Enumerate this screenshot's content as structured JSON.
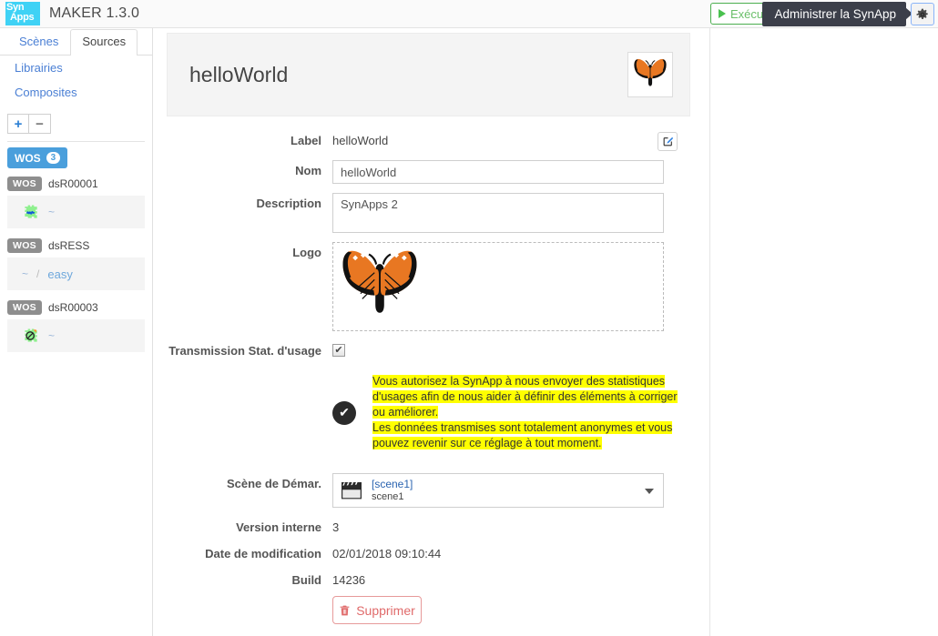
{
  "topbar": {
    "logo_line1": "Syn",
    "logo_line2": "Apps",
    "logo_color": "#3fd2f5",
    "title": "MAKER  1.3.0",
    "exec_label": "Exécuter",
    "gear_icon": "gear-icon",
    "tooltip": "Administrer la SynApp"
  },
  "sidebar": {
    "tabs": [
      {
        "label": "Scènes",
        "active": false
      },
      {
        "label": "Sources",
        "active": true
      }
    ],
    "links": [
      {
        "label": "Librairies"
      },
      {
        "label": "Composites"
      }
    ],
    "tools": {
      "add": "+",
      "remove": "−"
    },
    "tree_root": {
      "tag": "WOS",
      "count": "3"
    },
    "groups": [
      {
        "tag": "WOS",
        "name": "dsR00001",
        "icon": "wave-module-icon",
        "value": "~"
      },
      {
        "tag": "WOS",
        "name": "dsRESS",
        "value": "~",
        "separator": "/",
        "extra": "easy"
      },
      {
        "tag": "WOS",
        "name": "dsR00003",
        "icon": "globe-disabled-icon",
        "value": "~"
      }
    ]
  },
  "main": {
    "header": {
      "title": "helloWorld",
      "logo_icon": "butterfly-logo"
    },
    "fields": {
      "label_label": "Label",
      "label_value": "helloWorld",
      "edit_icon": "edit-square-icon",
      "nom_label": "Nom",
      "nom_value": "helloWorld",
      "description_label": "Description",
      "description_value": "SynApps 2",
      "logo_label": "Logo",
      "logo_icon": "butterfly-logo-large",
      "transmission_label": "Transmission Stat. d'usage",
      "transmission_checked": true,
      "scene_label": "Scène de Démar.",
      "scene_value_bracket": "[scene1]",
      "scene_value_name": "scene1",
      "scene_icon": "clapperboard-icon",
      "version_label": "Version interne",
      "version_value": "3",
      "date_label": "Date de modification",
      "date_value": "02/01/2018 09:10:44",
      "build_label": "Build",
      "build_value": "14236"
    },
    "notice": {
      "badge_icon": "check-circle-icon",
      "line1": "Vous autorisez la SynApp à nous envoyer des statistiques",
      "line2": "d'usages afin de nous aider à définir des éléments à corriger",
      "line3": "ou améliorer.",
      "line4": "Les données transmises sont totalement anonymes et vous",
      "line5": "pouvez revenir sur ce réglage à tout moment.",
      "highlight_color": "#ffff00"
    },
    "delete_button": {
      "label": "Supprimer",
      "icon": "trash-icon",
      "color": "#e06a6a"
    }
  }
}
